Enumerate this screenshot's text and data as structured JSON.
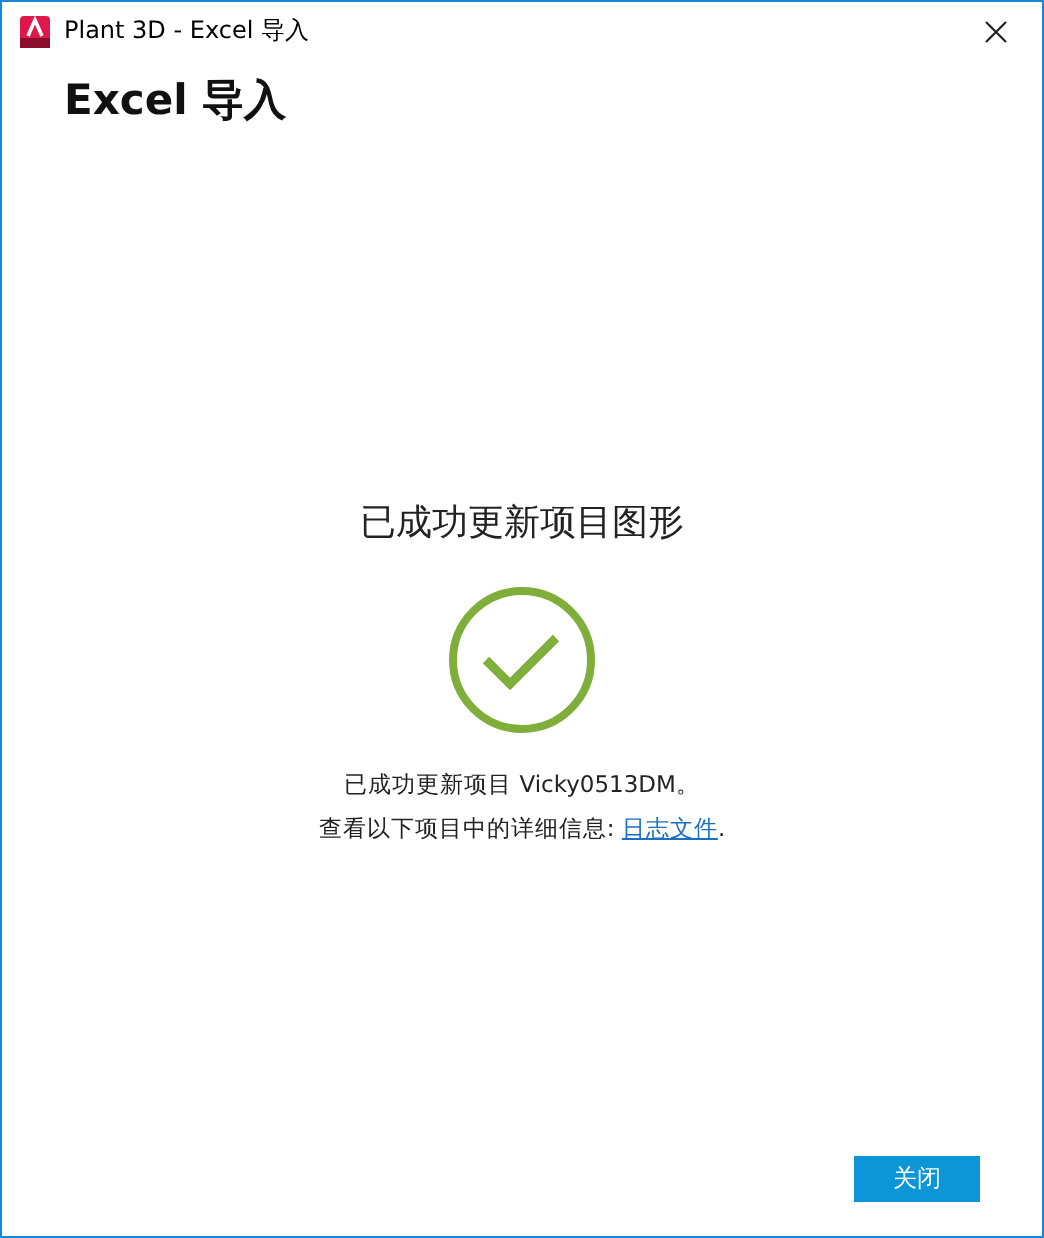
{
  "window": {
    "title": "Plant 3D - Excel 导入"
  },
  "heading": "Excel 导入",
  "result": {
    "title": "已成功更新项目图形",
    "message": "已成功更新项目 Vicky0513DM。",
    "details": "查看以下项目中的详细信息: ",
    "link": "日志文件",
    "details_end": "."
  },
  "buttons": [
    {
      "label": "关闭"
    }
  ]
}
